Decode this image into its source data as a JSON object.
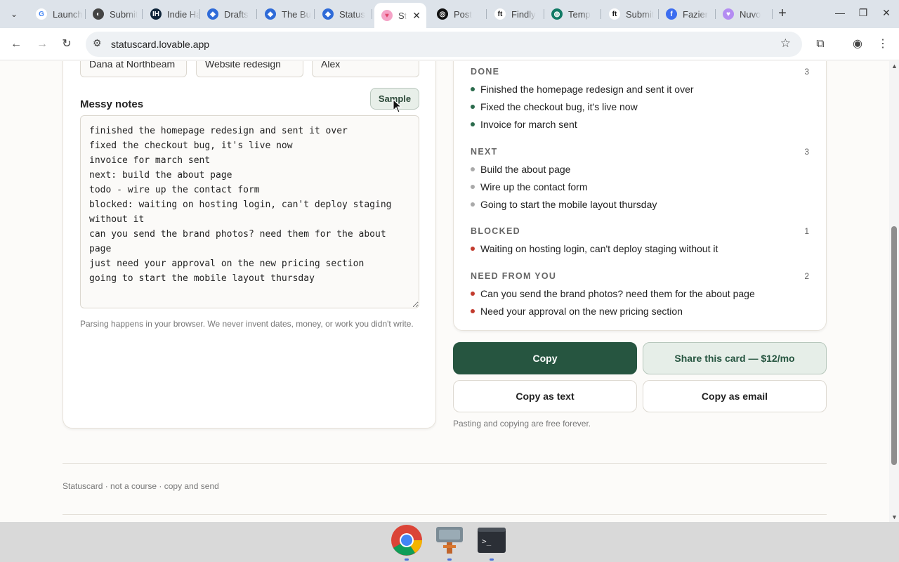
{
  "browser": {
    "tabs": [
      {
        "title": "Launch",
        "favicon_color": "#ffffff",
        "favicon_text": "G",
        "favicon_text_color": "#4285f4"
      },
      {
        "title": "Submit",
        "favicon_color": "#444444",
        "favicon_text": "◐",
        "favicon_text_color": "#ffffff"
      },
      {
        "title": "Indie Hackers",
        "favicon_color": "#0e2439",
        "favicon_text": "IH",
        "favicon_text_color": "#ffffff"
      },
      {
        "title": "Drafts",
        "favicon_color": "#2f6bd8",
        "favicon_text": "◆",
        "favicon_text_color": "#ffffff"
      },
      {
        "title": "The Bu",
        "favicon_color": "#2f6bd8",
        "favicon_text": "◆",
        "favicon_text_color": "#ffffff"
      },
      {
        "title": "Status",
        "favicon_color": "#2f6bd8",
        "favicon_text": "◆",
        "favicon_text_color": "#ffffff"
      },
      {
        "title": "St",
        "favicon_color": "#f5a3c7",
        "favicon_text": "♥",
        "favicon_text_color": "#e0456a",
        "active": true
      },
      {
        "title": "Post",
        "favicon_color": "#111111",
        "favicon_text": "◎",
        "favicon_text_color": "#ffffff"
      },
      {
        "title": "Findly",
        "favicon_color": "#ffffff",
        "favicon_text": "ft",
        "favicon_text_color": "#111111"
      },
      {
        "title": "Temp",
        "favicon_color": "#117a65",
        "favicon_text": "◍",
        "favicon_text_color": "#ffffff"
      },
      {
        "title": "Submit",
        "favicon_color": "#ffffff",
        "favicon_text": "ft",
        "favicon_text_color": "#111111"
      },
      {
        "title": "Fazier",
        "favicon_color": "#3c6df0",
        "favicon_text": "f",
        "favicon_text_color": "#ffffff"
      },
      {
        "title": "Nuvo",
        "favicon_color": "#b48cf2",
        "favicon_text": "♥",
        "favicon_text_color": "#ffffff"
      }
    ],
    "url": "statuscard.lovable.app"
  },
  "form": {
    "fields": [
      "Dana at Northbeam",
      "Website redesign",
      "Alex"
    ],
    "notes_label": "Messy notes",
    "sample_label": "Sample",
    "notes_text": "finished the homepage redesign and sent it over\nfixed the checkout bug, it's live now\ninvoice for march sent\nnext: build the about page\ntodo - wire up the contact form\nblocked: waiting on hosting login, can't deploy staging without it\ncan you send the brand photos? need them for the about page\njust need your approval on the new pricing section\ngoing to start the mobile layout thursday",
    "hint": "Parsing happens in your browser. We never invent dates, money, or work you didn't write."
  },
  "card": {
    "sections": [
      {
        "title": "DONE",
        "count": "3",
        "dot_color": "#2b6b4c",
        "items": [
          "Finished the homepage redesign and sent it over",
          "Fixed the checkout bug, it's live now",
          "Invoice for march sent"
        ]
      },
      {
        "title": "NEXT",
        "count": "3",
        "dot_color": "#a9a9a9",
        "items": [
          "Build the about page",
          "Wire up the contact form",
          "Going to start the mobile layout thursday"
        ]
      },
      {
        "title": "BLOCKED",
        "count": "1",
        "dot_color": "#c23b2e",
        "items": [
          "Waiting on hosting login, can't deploy staging without it"
        ]
      },
      {
        "title": "NEED FROM YOU",
        "count": "2",
        "dot_color": "#c23b2e",
        "items": [
          "Can you send the brand photos? need them for the about page",
          "Need your approval on the new pricing section"
        ]
      }
    ]
  },
  "actions": {
    "copy": "Copy",
    "share": "Share this card — $12/mo",
    "copy_text": "Copy as text",
    "copy_email": "Copy as email",
    "free_note": "Pasting and copying are free forever."
  },
  "footer": {
    "text": "Statuscard · not a course · copy and send"
  },
  "taskbar": {
    "apps": [
      "chrome-icon",
      "file-manager-icon",
      "terminal-icon"
    ]
  }
}
